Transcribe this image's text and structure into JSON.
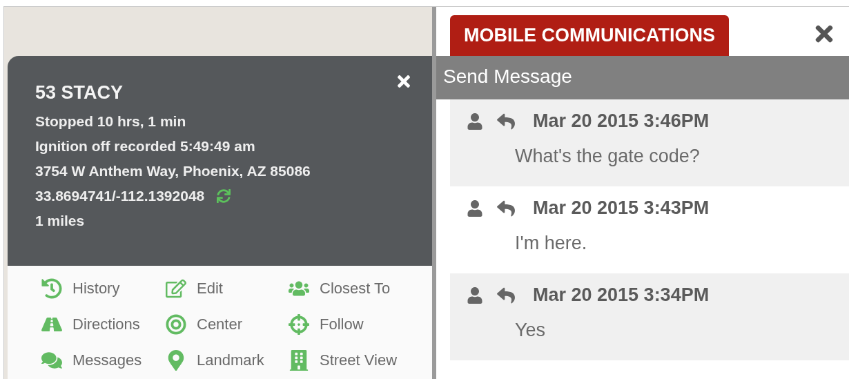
{
  "vehicle": {
    "name": "53 STACY",
    "details": [
      "Stopped 10 hrs, 1 min",
      "Ignition off recorded 5:49:49 am",
      "3754 W Anthem Way, Phoenix, AZ 85086"
    ],
    "coordinates": "33.8694741/-112.1392048",
    "distance": "1 miles"
  },
  "actions": [
    {
      "label": "History",
      "kind": "history"
    },
    {
      "label": "Edit",
      "kind": "edit"
    },
    {
      "label": "Closest To",
      "kind": "closest"
    },
    {
      "label": "Directions",
      "kind": "directions"
    },
    {
      "label": "Center",
      "kind": "center"
    },
    {
      "label": "Follow",
      "kind": "follow"
    },
    {
      "label": "Messages",
      "kind": "messages"
    },
    {
      "label": "Landmark",
      "kind": "landmark"
    },
    {
      "label": "Street View",
      "kind": "streetview"
    }
  ],
  "panel": {
    "title": "MOBILE COMMUNICATIONS",
    "section": "Send Message"
  },
  "messages": [
    {
      "time": "Mar 20 2015 3:46PM",
      "text": "What's the gate code?"
    },
    {
      "time": "Mar 20 2015 3:43PM",
      "text": "I'm here."
    },
    {
      "time": "Mar 20 2015 3:34PM",
      "text": "Yes"
    }
  ]
}
